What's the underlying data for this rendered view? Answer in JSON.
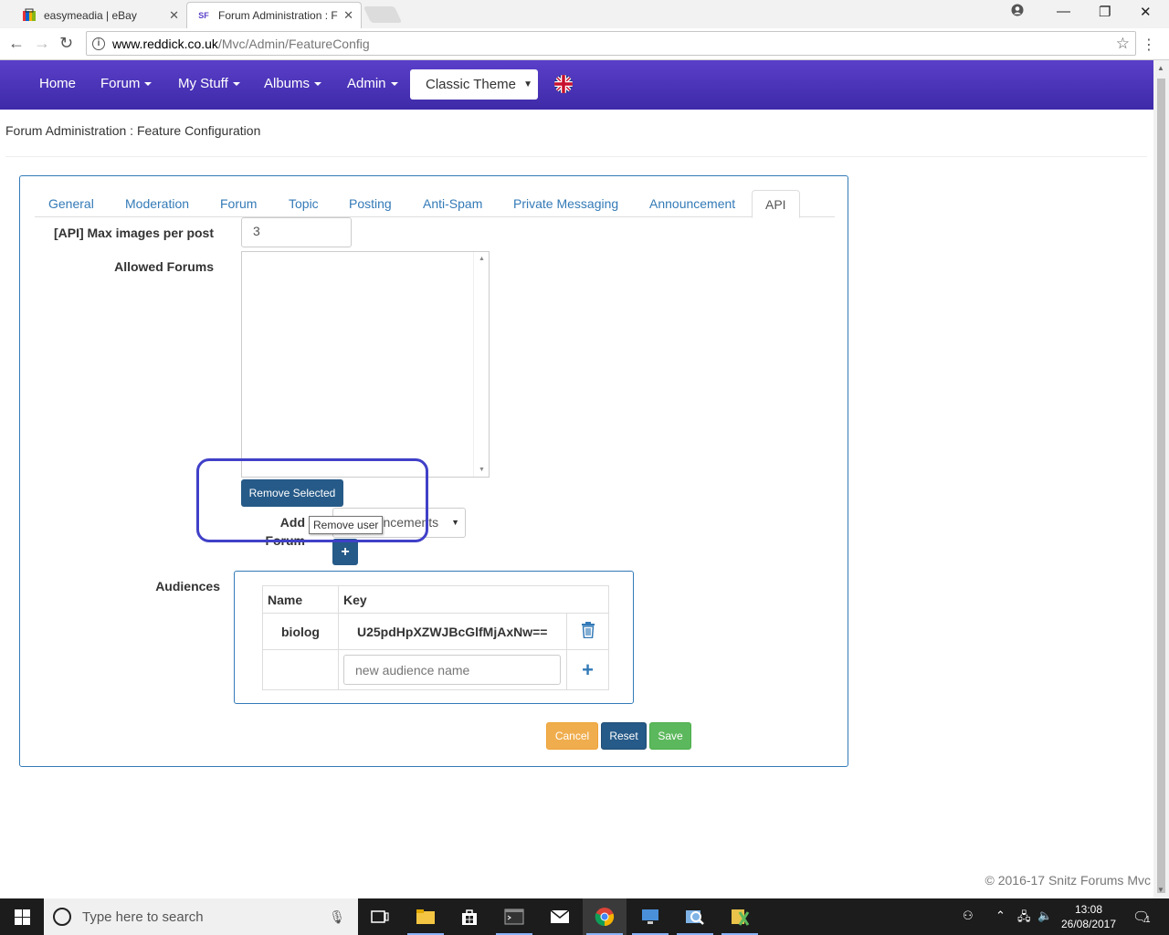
{
  "browser": {
    "tabs": [
      {
        "title": "easymeadia | eBay",
        "active": false
      },
      {
        "title": "Forum Administration : F",
        "active": true
      }
    ],
    "address": {
      "host": "www.reddick.co.uk",
      "path": "/Mvc/Admin/FeatureConfig"
    }
  },
  "navbar": {
    "items": [
      {
        "label": "Home",
        "dropdown": false
      },
      {
        "label": "Forum",
        "dropdown": true
      },
      {
        "label": "My Stuff",
        "dropdown": true
      },
      {
        "label": "Albums",
        "dropdown": true
      },
      {
        "label": "Admin",
        "dropdown": true
      }
    ],
    "theme_select": "Classic Theme"
  },
  "page": {
    "title": "Forum Administration : Feature Configuration",
    "tabs": [
      "General",
      "Moderation",
      "Forum",
      "Topic",
      "Posting",
      "Anti-Spam",
      "Private Messaging",
      "Announcement",
      "API"
    ],
    "active_tab": "API",
    "fields": {
      "max_images_label": "[API] Max images per post",
      "max_images_value": "3",
      "allowed_forums_label": "Allowed Forums",
      "remove_selected": "Remove Selected",
      "add_forum_label_1": "Add",
      "add_forum_label_2": "Forum",
      "forum_select_value": "Announcements",
      "add_forum_button": "+",
      "tooltip": "Remove user",
      "audiences_label": "Audiences"
    },
    "audiences": {
      "columns": [
        "Name",
        "Key"
      ],
      "rows": [
        {
          "name": "biolog",
          "key": "U25pdHpXZWJBcGlfMjAxNw=="
        }
      ],
      "new_placeholder": "new audience name"
    },
    "buttons": {
      "cancel": "Cancel",
      "reset": "Reset",
      "save": "Save"
    },
    "footer": "© 2016-17 Snitz Forums Mvc"
  },
  "taskbar": {
    "search_placeholder": "Type here to search",
    "time": "13:08",
    "date": "26/08/2017",
    "notification_count": "1"
  },
  "colors": {
    "navbar": "#4a33b8",
    "link": "#337ab7",
    "primary": "#265a88",
    "warning": "#f0ad4e",
    "success": "#5cb85c",
    "highlight": "#4040c8"
  }
}
